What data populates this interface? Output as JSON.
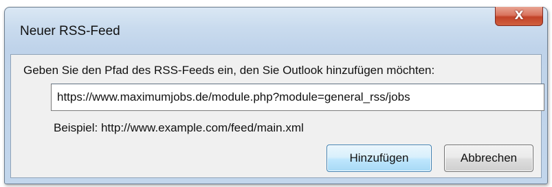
{
  "dialog": {
    "title": "Neuer RSS-Feed",
    "close_symbol": "X",
    "prompt": "Geben Sie den Pfad des RSS-Feeds ein, den Sie Outlook hinzufügen möchten:",
    "url_value": "https://www.maximumjobs.de/module.php?module=general_rss/jobs",
    "example": "Beispiel: http://www.example.com/feed/main.xml",
    "add_button": "Hinzufügen",
    "cancel_button": "Abbrechen"
  },
  "colors": {
    "close_red": "#c24328",
    "default_button_border": "#3c7fb1",
    "frame_blue": "#c9dbee"
  }
}
